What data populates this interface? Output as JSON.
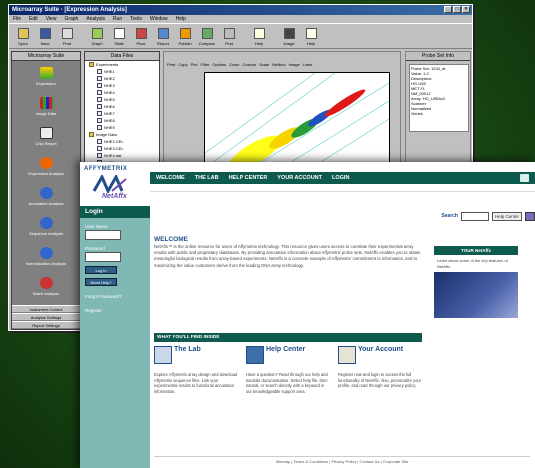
{
  "back_window": {
    "title": "Microarray Suite - [Expression Analysis]",
    "menu": [
      "File",
      "Edit",
      "View",
      "Graph",
      "Analysis",
      "Run",
      "Tools",
      "Window",
      "Help"
    ],
    "toolbar": [
      "Open",
      "Save",
      "Print",
      "Graph",
      "Table",
      "Pivot",
      "Report",
      "Publish",
      "Compare",
      "Find",
      "Help",
      "Image",
      "Help"
    ],
    "left_panel": {
      "header": "Microarray Suite",
      "modules": [
        "Expression",
        "Image Data",
        "Chip Report",
        "Expression Analysis",
        "Annotation Analysis",
        "Sequence Analysis",
        "Normalization Analysis",
        "Batch Analysis"
      ],
      "tabs": [
        "Instrument Control",
        "Analysis Settings",
        "Report Settings"
      ]
    },
    "tree": {
      "header": "Data Files",
      "groups": [
        {
          "name": "Experiments",
          "items": [
            "NHE1",
            "NHE2",
            "NHE3",
            "NHE4",
            "NHE5",
            "NHE6",
            "NHE7",
            "NHE8",
            "NHE9"
          ]
        },
        {
          "name": "Image Data",
          "items": [
            "NHE2.CEL",
            "NHE3.CEL",
            "NHE4.dat",
            "NHE5.dat",
            "NHE6.dat",
            "NHE7.dat"
          ]
        }
      ]
    },
    "main_toolbar": [
      "Print",
      "Copy",
      "Plot",
      "Filter",
      "Options",
      "Zoom",
      "Custom",
      "Scale",
      "Method",
      "Image",
      "Lines"
    ],
    "info_panel": {
      "header": "Probe Set Info",
      "text": "Probe Set: 1234_at\nValue: 1.2\nDescription:\nHG-U95\nMET FL\nNM_00012\nArray: HG_U95Av2\nScanner\nNormalized\nGenes"
    }
  },
  "front_window": {
    "logo": {
      "company": "AFFYMETRIX",
      "product": "NetAffx"
    },
    "nav": [
      "WELCOME",
      "THE LAB",
      "HELP CENTER",
      "YOUR ACCOUNT",
      "LOGIN"
    ],
    "search": {
      "label": "Search",
      "select": "Help Center"
    },
    "sidebar": {
      "title": "Login",
      "user_label": "User Name",
      "pass_label": "Password",
      "login_button": "Log In",
      "help_button": "Need Help?",
      "forgot": "Forgot Password?",
      "register": "Register"
    },
    "welcome": {
      "title": "WELCOME",
      "body": "NetAffx™ is the online resource for users of Affymetrix technology. This resource gives users access to correlate their experimental array results with public and proprietary databases. By providing annotation information about Affymetrix probe sets, NetAffx enables you to obtain meaningful biological results from array-based experiments. NetAffx is a concrete example of Affymetrix' commitment to informatics, and to maximizing the value customers derive from the leading DNA array technology."
    },
    "inside_title": "WHAT YOU'LL FIND INSIDE",
    "columns": [
      {
        "title": "The Lab",
        "body": "Explore Affymetrix array design and download Affymetrix sequence files. Link your experimental results to functional annotation information."
      },
      {
        "title": "Help Center",
        "body": "Have a question? Read through our help and tutorials documentation. Select help file, then tutorial, or search directly with a keyword in our knowledgeable support area."
      },
      {
        "title": "Your Account",
        "body": "Register now and login to access the full functionality of NetAffx. Also, personalize your profile, and read through our privacy policy."
      }
    ],
    "right_box": {
      "title": "TOUR NetAffx",
      "body": "Learn about some of the key features of NetAffx."
    },
    "footer": "Sitemap | Terms & Conditions | Privacy Policy | Contact Us | Corporate Site"
  }
}
